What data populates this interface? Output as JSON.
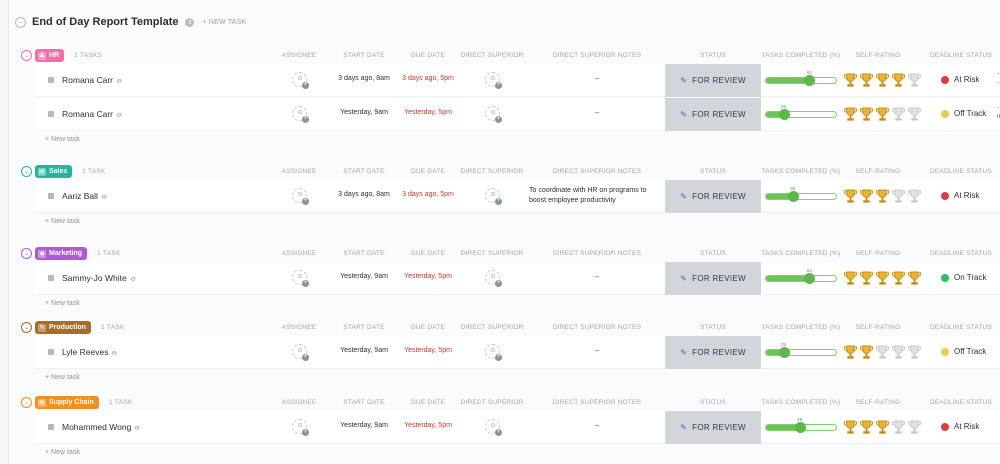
{
  "header": {
    "title": "End of Day Report Template",
    "info": "i",
    "new_task": "+ NEW TASK"
  },
  "columns": {
    "assignee": "ASSIGNEE",
    "start": "START DATE",
    "due": "DUE DATE",
    "superior": "DIRECT SUPERIOR",
    "notes": "DIRECT SUPERIOR NOTES",
    "status": "STATUS",
    "completed": "TASKS COMPLETED (%)",
    "rating": "SELF-RATING",
    "deadline": "DEADLINE STATUS"
  },
  "new_task_label": "+ New task",
  "status_label": "FOR REVIEW",
  "colors": {
    "at_risk": "#e03b3b",
    "off_track": "#f2c94c",
    "on_track": "#2fbf5b"
  },
  "groups": [
    {
      "name": "HR",
      "icon": "hr-icon",
      "color": "#f06fa9",
      "count": "2 TASKS",
      "tasks": [
        {
          "name": "Romana Carr",
          "start": "3 days ago, 8am",
          "due": "3 days ago, 5pm",
          "notes": "–",
          "progress": 62,
          "rating": 4,
          "deadline": "At Risk",
          "deadline_color": "#e03b3b",
          "extra": [
            "- U",
            "- C"
          ]
        },
        {
          "name": "Romana Carr",
          "start": "Yesterday, 9am",
          "due": "Yesterday, 5pm",
          "notes": "–",
          "progress": 25,
          "rating": 3,
          "deadline": "Off Track",
          "deadline_color": "#f2c94c",
          "extra": [
            "- A",
            "me"
          ]
        }
      ]
    },
    {
      "name": "Sales",
      "icon": "sales-icon",
      "color": "#26b59a",
      "count": "1 TASK",
      "tasks": [
        {
          "name": "Aariz Ball",
          "start": "3 days ago, 8am",
          "due": "3 days ago, 5pm",
          "notes": "To coordinate with HR on programs to boost employee productivity",
          "progress": 38,
          "rating": 3,
          "deadline": "At Risk",
          "deadline_color": "#e03b3b",
          "extra": []
        }
      ]
    },
    {
      "name": "Marketing",
      "icon": "marketing-icon",
      "color": "#b05ad6",
      "count": "1 TASK",
      "tasks": [
        {
          "name": "Sammy-Jo White",
          "start": "Yesterday, 9am",
          "due": "Yesterday, 5pm",
          "notes": "–",
          "progress": 62,
          "rating": 5,
          "deadline": "On Track",
          "deadline_color": "#2fbf5b",
          "extra": []
        }
      ]
    },
    {
      "name": "Production",
      "icon": "production-icon",
      "color": "#a86b2a",
      "count": "1 TASK",
      "tasks": [
        {
          "name": "Lyle Reeves",
          "start": "Yesterday, 9am",
          "due": "Yesterday, 5pm",
          "notes": "–",
          "progress": 25,
          "rating": 2,
          "deadline": "Off Track",
          "deadline_color": "#f2c94c",
          "extra": []
        }
      ]
    },
    {
      "name": "Supply Chain",
      "icon": "supply-chain-icon",
      "color": "#f0901e",
      "count": "1 TASK",
      "tasks": [
        {
          "name": "Mohammed Wong",
          "start": "Yesterday, 9am",
          "due": "Yesterday, 5pm",
          "notes": "–",
          "progress": 48,
          "rating": 3,
          "deadline": "At Risk",
          "deadline_color": "#e03b3b",
          "extra": []
        }
      ]
    }
  ]
}
